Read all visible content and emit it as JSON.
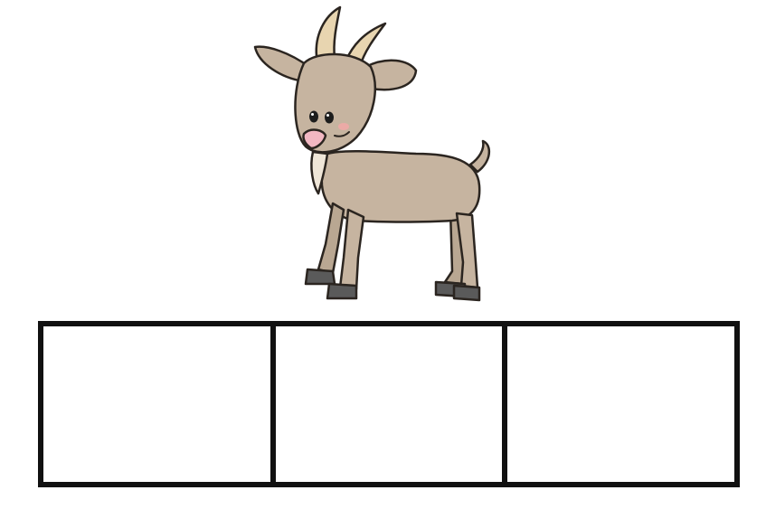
{
  "illustration": {
    "subject": "goat",
    "icon": "goat-icon",
    "colors": {
      "body": "#c6b4a0",
      "outline": "#2b2520",
      "horns": "#e8d5b0",
      "hooves": "#5a5a5a",
      "nose": "#f2b7c2",
      "cheek": "#f4a7a7"
    }
  },
  "boxes": {
    "count": 3,
    "border_color": "#111111",
    "fill_color": "#ffffff"
  }
}
